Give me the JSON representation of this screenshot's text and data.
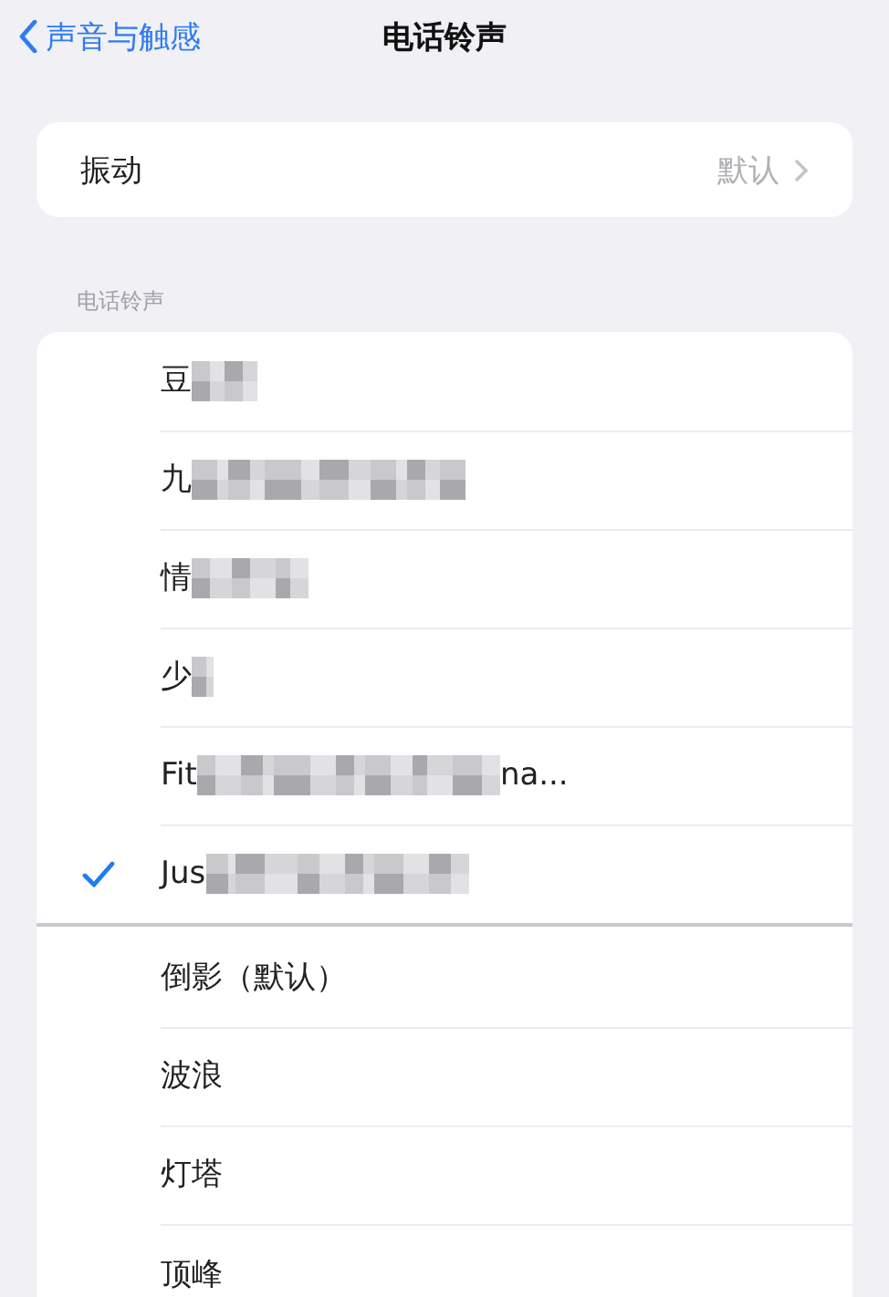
{
  "nav": {
    "back": "声音与触感",
    "title": "电话铃声"
  },
  "vibration": {
    "label": "振动",
    "value": "默认"
  },
  "section_header": "电话铃声",
  "groups": [
    {
      "rows": [
        {
          "label": "豆",
          "redacted": true,
          "selected": false
        },
        {
          "label": "九",
          "redacted": true,
          "selected": false
        },
        {
          "label": "情",
          "redacted": true,
          "selected": false
        },
        {
          "label": "少",
          "redacted": true,
          "selected": false
        },
        {
          "label": "Fit",
          "redacted": true,
          "suffix": "na...",
          "selected": false
        },
        {
          "label": "Jus",
          "redacted": true,
          "selected": true
        }
      ]
    },
    {
      "rows": [
        {
          "label": "倒影（默认）",
          "redacted": false,
          "selected": false
        },
        {
          "label": "波浪",
          "redacted": false,
          "selected": false
        },
        {
          "label": "灯塔",
          "redacted": false,
          "selected": false
        },
        {
          "label": "顶峰",
          "redacted": false,
          "selected": false
        }
      ]
    }
  ]
}
